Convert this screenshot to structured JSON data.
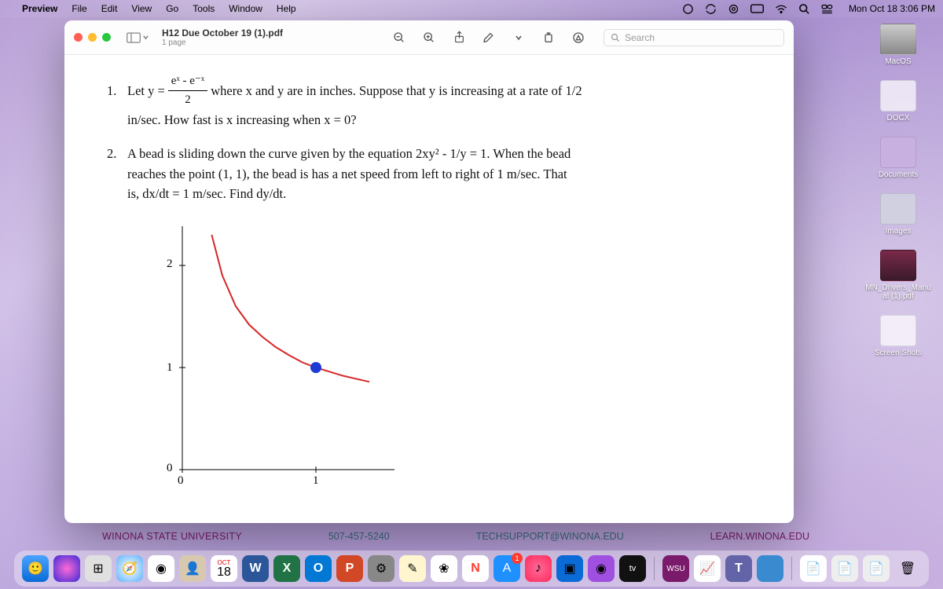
{
  "menubar": {
    "app": "Preview",
    "items": [
      "File",
      "Edit",
      "View",
      "Go",
      "Tools",
      "Window",
      "Help"
    ],
    "clock": "Mon Oct 18  3:06 PM"
  },
  "window": {
    "filename": "H12 Due October 19 (1).pdf",
    "subtitle": "1 page",
    "search_placeholder": "Search"
  },
  "doc": {
    "p1_num": "1.",
    "p1_lead": "Let y =",
    "p1_frac_num": "eˣ - e⁻ˣ",
    "p1_frac_den": "2",
    "p1_tail1": " where x and y are in inches.  Suppose that y is increasing at a rate of 1/2",
    "p1_tail2": "in/sec.  How fast is x increasing when x = 0?",
    "p2_num": "2.",
    "p2_body1": "A bead is sliding down the curve given by the equation 2xy² - 1/y = 1.  When the bead",
    "p2_body2": "reaches the point (1, 1), the bead is has a net speed from left to right of 1 m/sec.  That",
    "p2_body3": "is, dx/dt = 1 m/sec.  Find dy/dt.",
    "plot_x0": "0",
    "plot_x1": "1",
    "plot_y0": "0",
    "plot_y1": "1",
    "plot_y2": "2"
  },
  "desktop": {
    "items": [
      {
        "label": "MacOS"
      },
      {
        "label": "DOCX"
      },
      {
        "label": "Documents"
      },
      {
        "label": "Images"
      },
      {
        "label": "MN_Drivers_Manual (1).pdf"
      },
      {
        "label": "Screen Shots"
      }
    ]
  },
  "banner": {
    "uni": "WINONA STATE UNIVERSITY",
    "phone": "507-457-5240",
    "email": "TECHSUPPORT@WINONA.EDU",
    "url": "LEARN.WINONA.EDU"
  },
  "dock": {
    "cal_month": "OCT",
    "cal_day": "18",
    "tv_label": "tv",
    "appstore_badge": "1",
    "wsu_label": "WSU"
  },
  "chart_data": {
    "type": "line",
    "title": "",
    "xlabel": "",
    "ylabel": "",
    "xlim": [
      0,
      1.4
    ],
    "ylim": [
      0,
      2.3
    ],
    "xticks": [
      0,
      1
    ],
    "yticks": [
      0,
      1,
      2
    ],
    "series": [
      {
        "name": "curve 2xy^2 - 1/y = 1",
        "color": "#d62728",
        "x": [
          0.22,
          0.3,
          0.4,
          0.5,
          0.6,
          0.7,
          0.8,
          0.9,
          1.0,
          1.1,
          1.2,
          1.3,
          1.4
        ],
        "y": [
          2.3,
          1.9,
          1.6,
          1.42,
          1.3,
          1.2,
          1.12,
          1.05,
          1.0,
          0.96,
          0.92,
          0.89,
          0.86
        ]
      }
    ],
    "point": {
      "x": 1.0,
      "y": 1.0,
      "color": "#1f3bd6"
    }
  }
}
